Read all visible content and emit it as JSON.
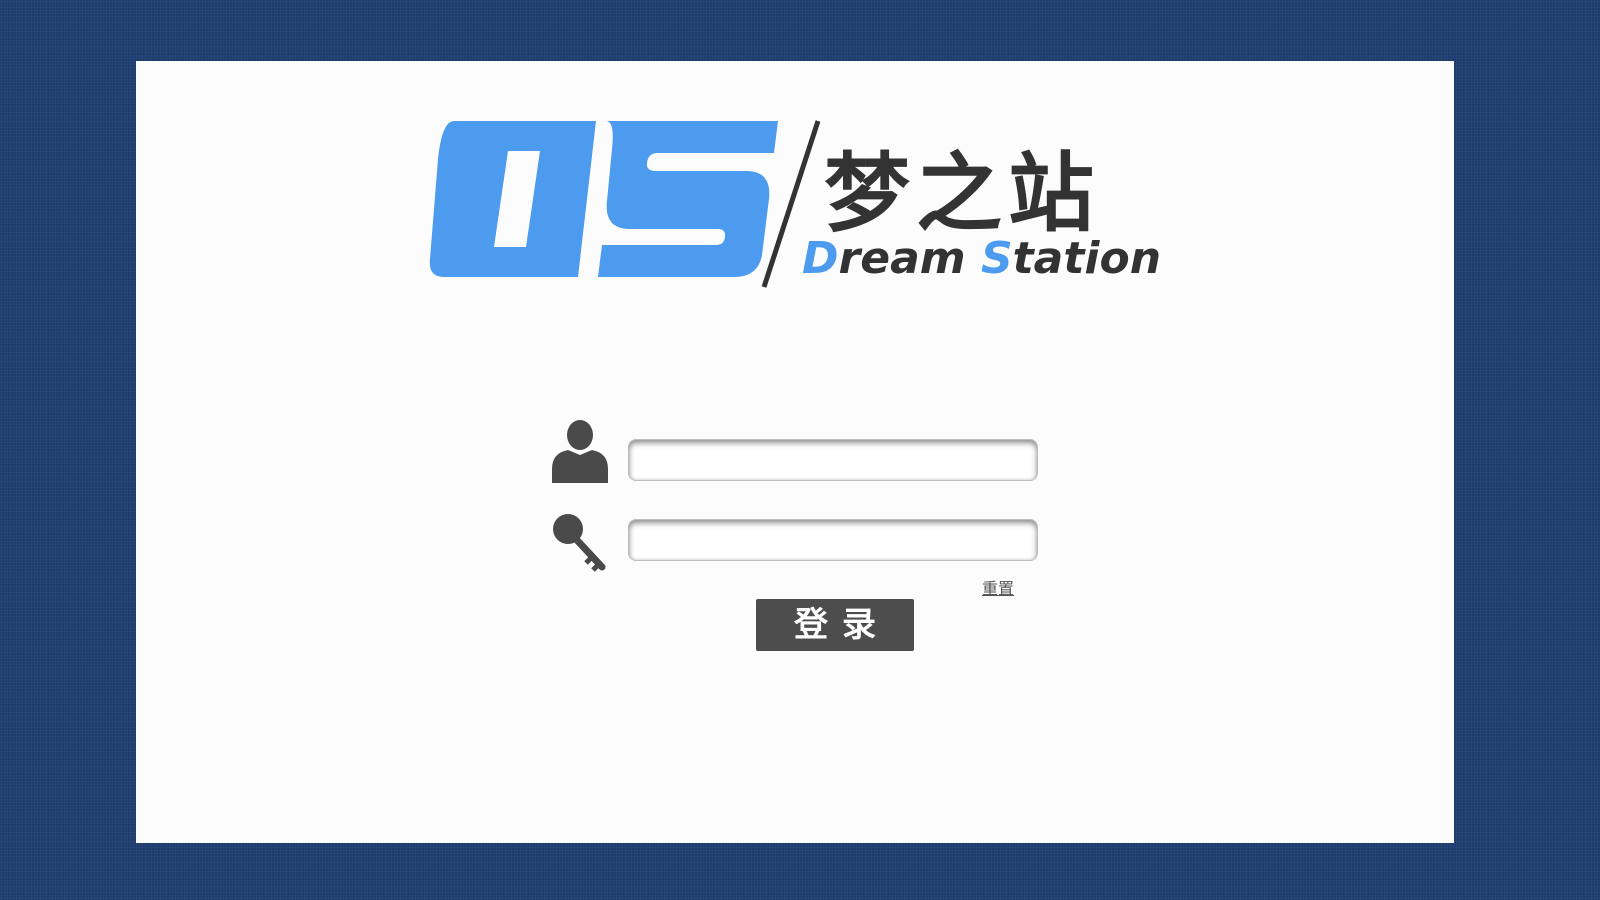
{
  "logo": {
    "mark": "DS",
    "chinese_name": "梦之站",
    "english_initial_1": "D",
    "english_rest_1": "ream ",
    "english_initial_2": "S",
    "english_rest_2": "tation",
    "brand_color": "#4c9bee",
    "dark_color": "#333333"
  },
  "form": {
    "username": {
      "icon": "user-icon",
      "value": "",
      "placeholder": ""
    },
    "password": {
      "icon": "key-icon",
      "value": "",
      "placeholder": ""
    },
    "reset_label": "重置",
    "login_label": "登录"
  },
  "colors": {
    "background": "#1e3d70",
    "panel": "#fcfcfd",
    "button": "#4d4d4d"
  }
}
